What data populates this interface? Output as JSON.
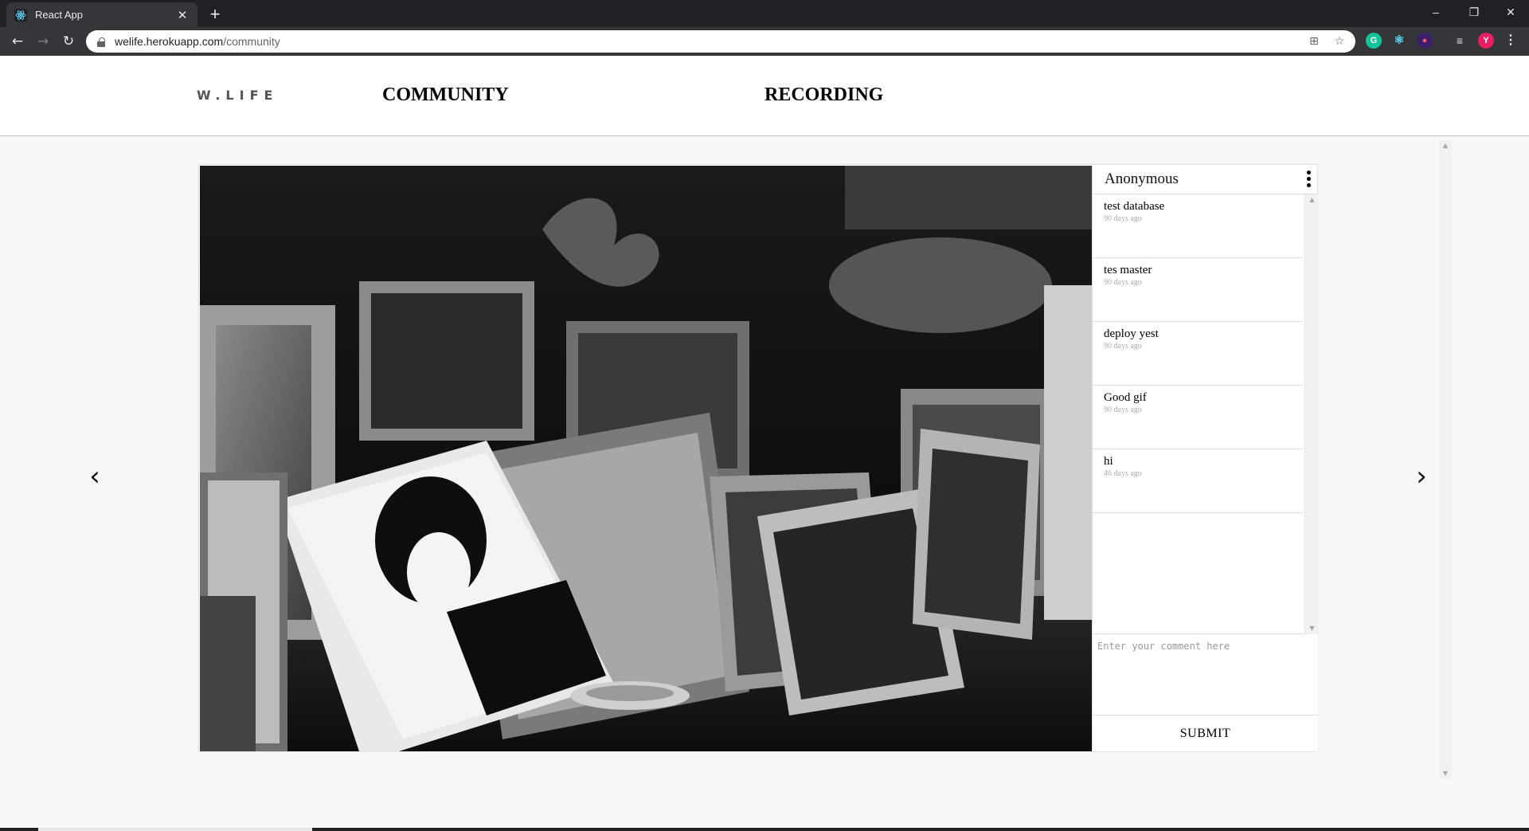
{
  "browser": {
    "tab_title": "React App",
    "url_host": "welife.herokuapp.com",
    "url_path": "/community",
    "profile_initial": "Y"
  },
  "app": {
    "logo": "W.LIFE",
    "nav": {
      "community": "COMMUNITY",
      "recording": "RECORDING"
    },
    "carousel": {
      "prev": "‹",
      "next": "›"
    },
    "post": {
      "author": "Anonymous",
      "image_alt": "Black and white photo of framed portraits on a mantel",
      "comments": [
        {
          "text": "test database",
          "time": "90 days ago"
        },
        {
          "text": "tes master",
          "time": "90 days ago"
        },
        {
          "text": "deploy yest",
          "time": "90 days ago"
        },
        {
          "text": "Good gif",
          "time": "90 days ago"
        },
        {
          "text": "hi",
          "time": "46 days ago"
        }
      ],
      "comment_placeholder": "Enter your comment here",
      "submit_label": "SUBMIT"
    }
  }
}
